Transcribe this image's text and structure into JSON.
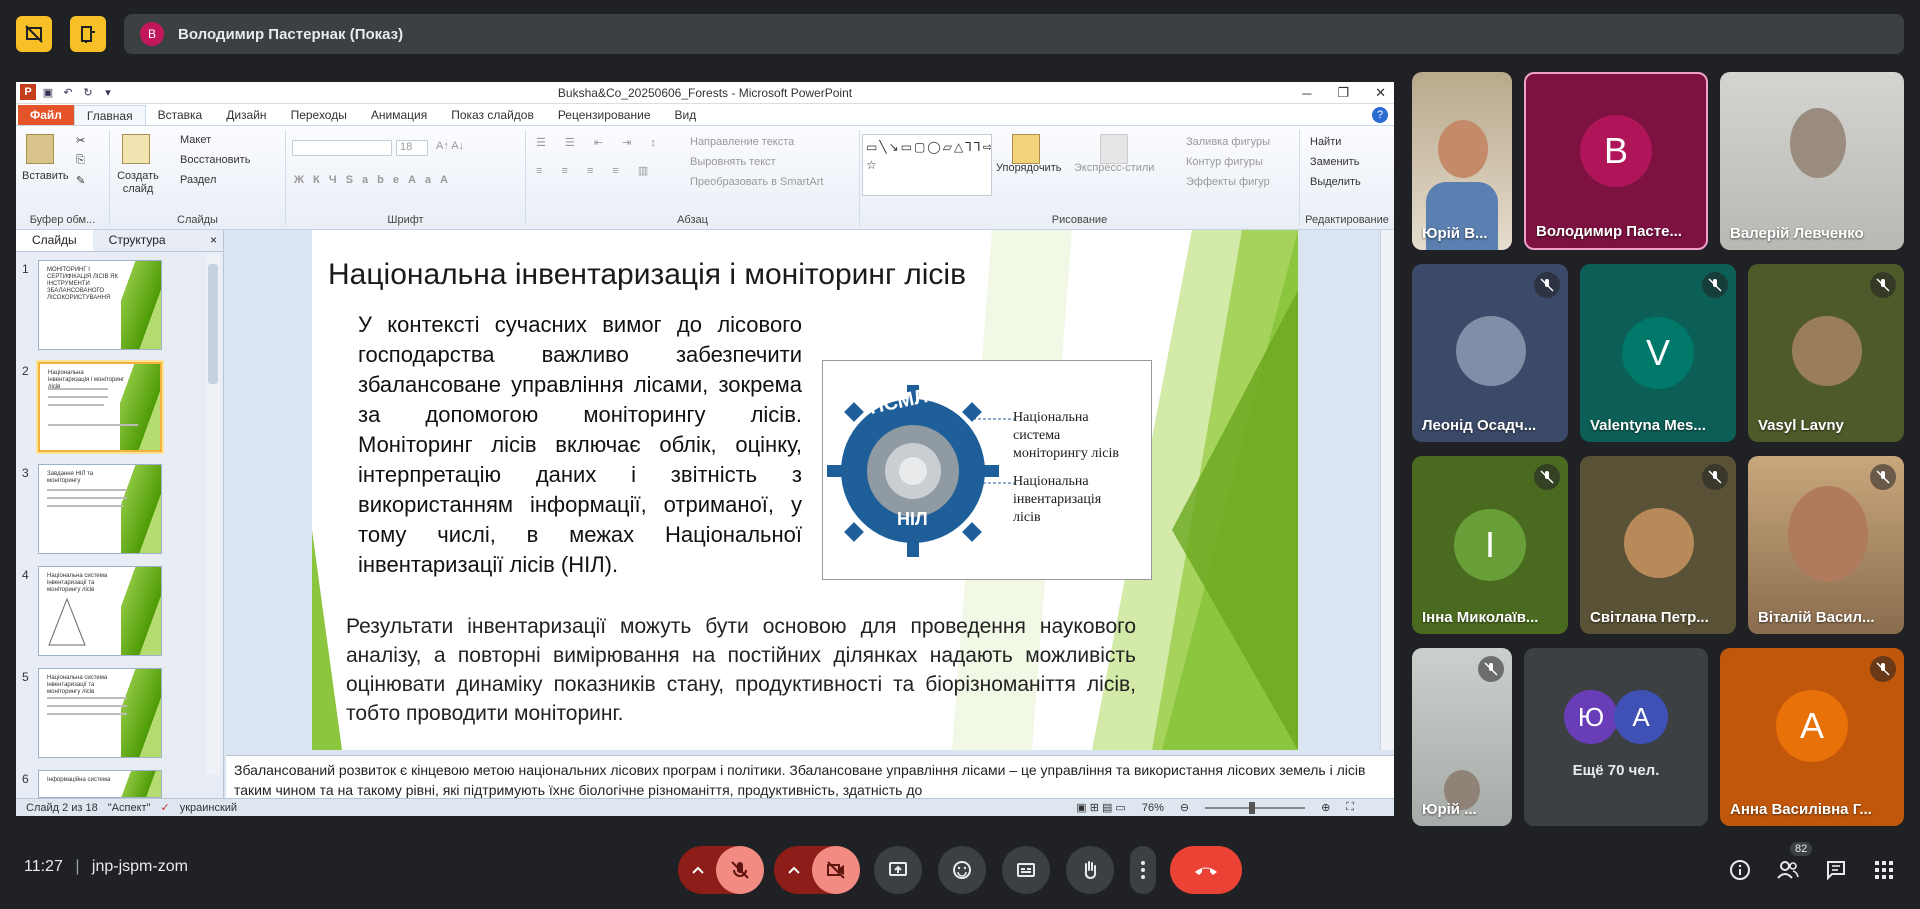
{
  "meeting": {
    "presenter_initial": "В",
    "presenter_label": "Володимир Пастернак (Показ)",
    "time": "11:27",
    "separator": "|",
    "code": "jnp-jspm-zom",
    "participant_count": "82"
  },
  "ppt": {
    "window_title": "Buksha&Co_20250606_Forests - Microsoft PowerPoint",
    "tabs": [
      "Файл",
      "Главная",
      "Вставка",
      "Дизайн",
      "Переходы",
      "Анимация",
      "Показ слайдов",
      "Рецензирование",
      "Вид"
    ],
    "ribbon": {
      "paste": "Вставить",
      "clipboard": "Буфер обм...",
      "create_slide": "Создать слайд",
      "layout": "Макет",
      "restore": "Восстановить",
      "section": "Раздел",
      "slides_group": "Слайды",
      "font_size": "18",
      "font_group": "Шрифт",
      "text_direction": "Направление текста",
      "align_text": "Выровнять текст",
      "smartart": "Преобразовать в SmartArt",
      "paragraph_group": "Абзац",
      "arrange": "Упорядочить",
      "express_styles": "Экспресс-стили",
      "shape_fill": "Заливка фигуры",
      "shape_outline": "Контур фигуры",
      "shape_effects": "Эффекты фигур",
      "drawing_group": "Рисование",
      "find": "Найти",
      "replace": "Заменить",
      "select": "Выделить",
      "editing_group": "Редактирование"
    },
    "panel_tabs": [
      "Слайды",
      "Структура"
    ],
    "panel_close": "×",
    "thumbs": [
      {
        "num": "1",
        "title": "МОНІТОРИНГ І СЕРТИФІКАЦІЯ ЛІСІВ ЯК ІНСТРУМЕНТИ ЗБАЛАНСОВАНОГО ЛІСОКОРИСТУВАННЯ"
      },
      {
        "num": "2",
        "title": "Національна інвентаризація і моніторинг лісів"
      },
      {
        "num": "3",
        "title": "Завдання НІЛ та моніторингу"
      },
      {
        "num": "4",
        "title": "Національна система інвентаризації та моніторингу лісів"
      },
      {
        "num": "5",
        "title": "Національна система інвентаризації та моніторингу лісів"
      },
      {
        "num": "6",
        "title": "Інформаційна система"
      }
    ],
    "slide": {
      "title": "Національна інвентаризація і моніторинг лісів",
      "para1": "У контексті сучасних вимог до лісового господарства важливо забезпечити збалансоване управління лісами, зокрема за допомогою моніторингу лісів. Моніторинг лісів включає облік, оцінку, інтерпретацію даних і звітність з використанням інформації, отриманої, у тому числі, в межах Національної інвентаризації лісів (НІЛ).",
      "para2": "Результати інвентаризації можуть бути основою для проведення наукового аналізу, а повторні вимірювання на постійних ділянках надають можливість оцінювати динаміку показників стану, продуктивності та біорізноманіття лісів, тобто проводити моніторинг.",
      "logo_top": "НСМЛ",
      "logo_bottom": "НІЛ",
      "label1": "Національна система моніторингу лісів",
      "label2": "Національна інвентаризація лісів"
    },
    "notes": "Збалансований розвиток є кінцевою метою національних лісових програм і політики. Збалансоване управління лісами – це управління та використання лісових земель і лісів таким чином та на такому рівні, які підтримують їхнє біологічне різноманіття, продуктивність, здатність до",
    "status": {
      "slide": "Слайд 2 из 18",
      "theme": "\"Аспект\"",
      "lang": "украинский",
      "zoom": "76%"
    }
  },
  "participants": [
    {
      "name": "Юрій В...",
      "type": "photo"
    },
    {
      "name": "Володимир Пасте...",
      "initial": "В",
      "color": "#b0155a",
      "type": "avatar"
    },
    {
      "name": "Валерій Левченко",
      "type": "photo"
    },
    {
      "name": "Леонід Осадч...",
      "type": "photo"
    },
    {
      "name": "Valentyna Mes...",
      "initial": "V",
      "color": "#00796b",
      "type": "avatar"
    },
    {
      "name": "Vasyl Lavny",
      "type": "photo"
    },
    {
      "name": "Інна Миколаїв...",
      "initial": "І",
      "color": "#689f38",
      "type": "avatar"
    },
    {
      "name": "Світлана Петр...",
      "type": "photo"
    },
    {
      "name": "Віталій Васил...",
      "type": "photo"
    },
    {
      "name": "Юрій ...",
      "type": "photo"
    },
    {
      "name": "Ещё 70 чел.",
      "initials": [
        "Ю",
        "А"
      ],
      "type": "more"
    },
    {
      "name": "Анна Василівна Г...",
      "initial": "А",
      "color": "#e8710a",
      "type": "avatar"
    }
  ]
}
